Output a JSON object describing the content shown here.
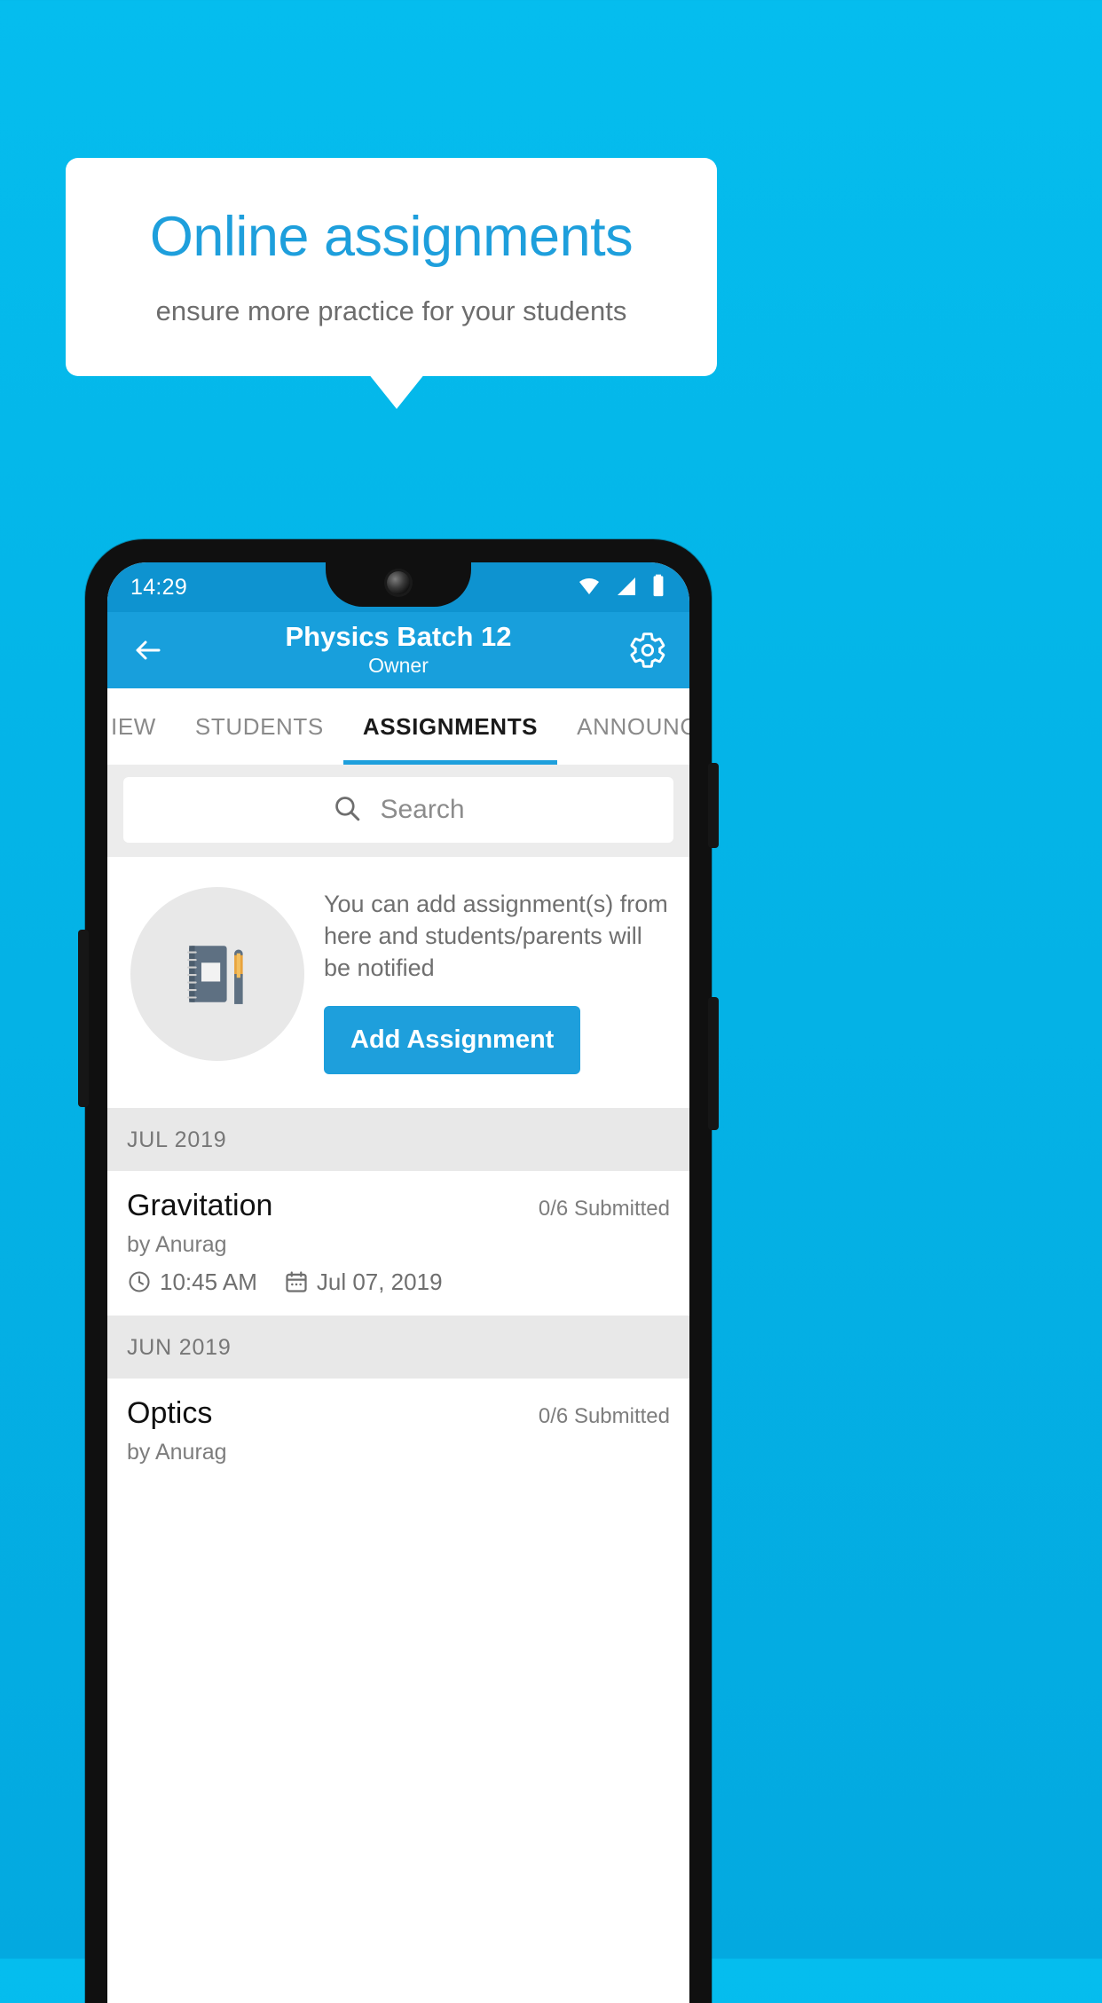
{
  "promo": {
    "headline": "Online assignments",
    "subhead": "ensure more practice for your students"
  },
  "phone": {
    "status_bar": {
      "time": "14:29",
      "icons": [
        "wifi-icon",
        "signal-icon",
        "battery-icon"
      ]
    },
    "app_bar": {
      "back_icon": "back-arrow-icon",
      "title": "Physics Batch 12",
      "subtitle": "Owner",
      "settings_icon": "gear-icon"
    },
    "tabs": [
      {
        "label": "IEW",
        "active": false
      },
      {
        "label": "STUDENTS",
        "active": false
      },
      {
        "label": "ASSIGNMENTS",
        "active": true
      },
      {
        "label": "ANNOUNCEN",
        "active": false
      }
    ],
    "search": {
      "placeholder": "Search",
      "icon": "search-icon"
    },
    "empty_state": {
      "illustration": "notebook-and-pen-icon",
      "text": "You can add assignment(s) from here and students/parents will be notified",
      "button_label": "Add Assignment"
    },
    "sections": [
      {
        "month": "JUL 2019",
        "items": [
          {
            "title": "Gravitation",
            "submitted": "0/6 Submitted",
            "by": "by Anurag",
            "time": "10:45 AM",
            "date": "Jul 07, 2019"
          }
        ]
      },
      {
        "month": "JUN 2019",
        "items": [
          {
            "title": "Optics",
            "submitted": "0/6 Submitted",
            "by": "by Anurag",
            "time": "",
            "date": ""
          }
        ]
      }
    ]
  },
  "colors": {
    "background": "#05BDEE",
    "accent": "#1E9FDC",
    "status_bar": "#0E93D0",
    "app_bar": "#189FDC",
    "section_header": "#E8E8E8"
  }
}
